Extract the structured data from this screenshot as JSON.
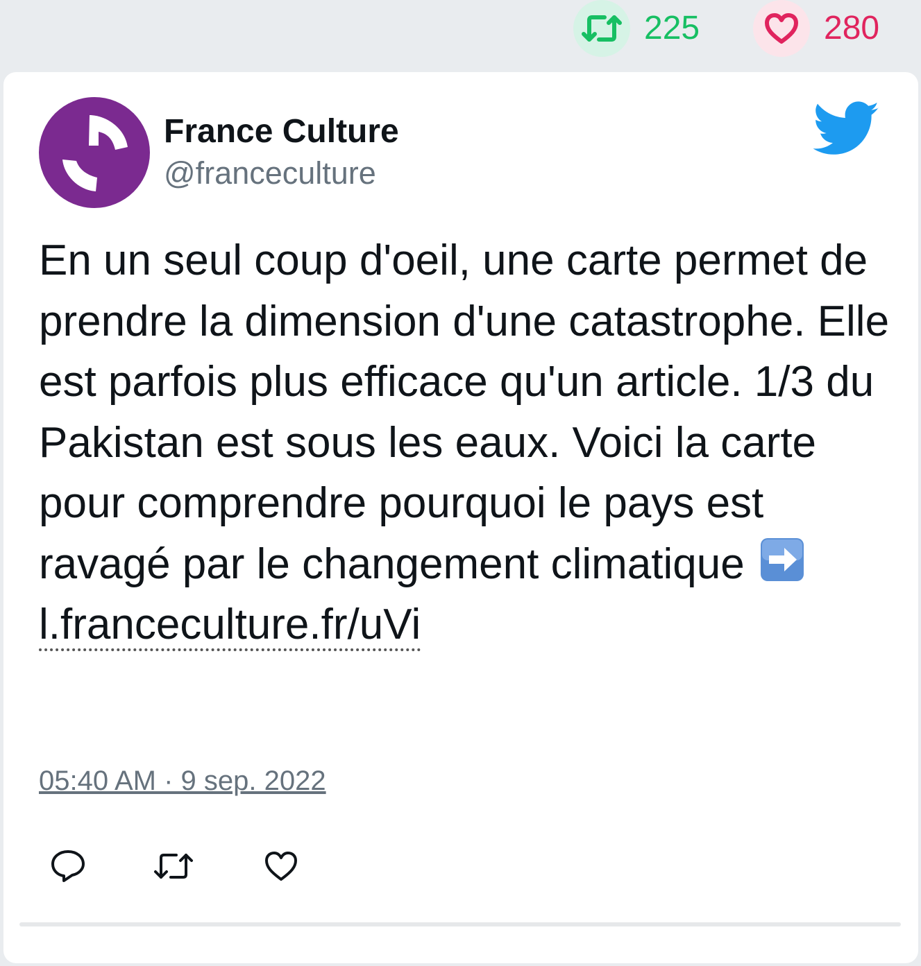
{
  "stats": {
    "retweets": "225",
    "likes": "280"
  },
  "tweet": {
    "display_name": "France Culture",
    "handle": "@franceculture",
    "text": "En un seul coup d'oeil, une carte permet de prendre la dimension d'une catastrophe. Elle est parfois plus efficace qu'un article. 1/3 du Pakistan est sous les eaux. Voici la carte pour comprendre pourquoi le pays est ravagé par le changement climatique",
    "emoji": "arrow-right-emoji",
    "link": "l.franceculture.fr/uVi",
    "timestamp": "05:40 AM · 9 sep. 2022"
  },
  "icons": {
    "retweet_stat": "retweet-icon",
    "like_stat": "heart-icon",
    "brand": "twitter-bird-icon",
    "reply_action": "reply-icon",
    "retweet_action": "retweet-icon",
    "like_action": "heart-icon"
  },
  "colors": {
    "retweet_green": "#17bf63",
    "like_red": "#e0245e",
    "twitter_blue": "#1d9bf0",
    "avatar_purple": "#7b2a90",
    "handle_gray": "#66727d"
  }
}
